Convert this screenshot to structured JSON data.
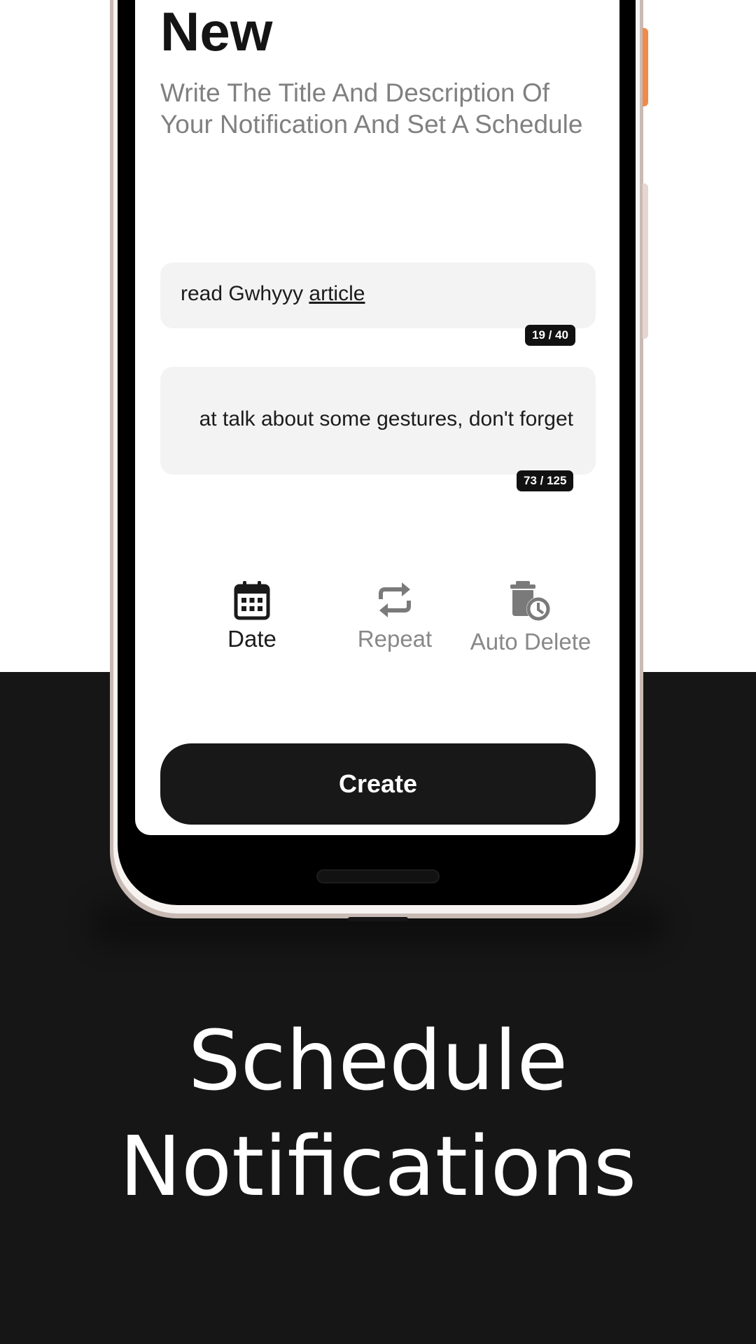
{
  "screen": {
    "title": "New",
    "subtitle": "Write The Title And Description Of Your Notification And Set A Schedule",
    "title_field": {
      "value_plain": "read Gwhyyy ",
      "value_underlined": "article",
      "counter": "19 / 40"
    },
    "description_field": {
      "value": "at talk about some gestures, don't forget",
      "counter": "73 / 125"
    },
    "options": [
      {
        "label": "Date",
        "icon": "calendar-icon",
        "active": true
      },
      {
        "label": "Repeat",
        "icon": "repeat-icon",
        "active": false
      },
      {
        "label": "Auto Delete",
        "icon": "auto-delete-icon",
        "active": false
      }
    ],
    "create_label": "Create"
  },
  "tagline": {
    "line1": "Schedule",
    "line2": "Notifications"
  },
  "colors": {
    "primary_dark": "#161616",
    "accent_orange": "#f08a4b",
    "muted_text": "#808080",
    "field_bg": "#f3f3f3"
  }
}
